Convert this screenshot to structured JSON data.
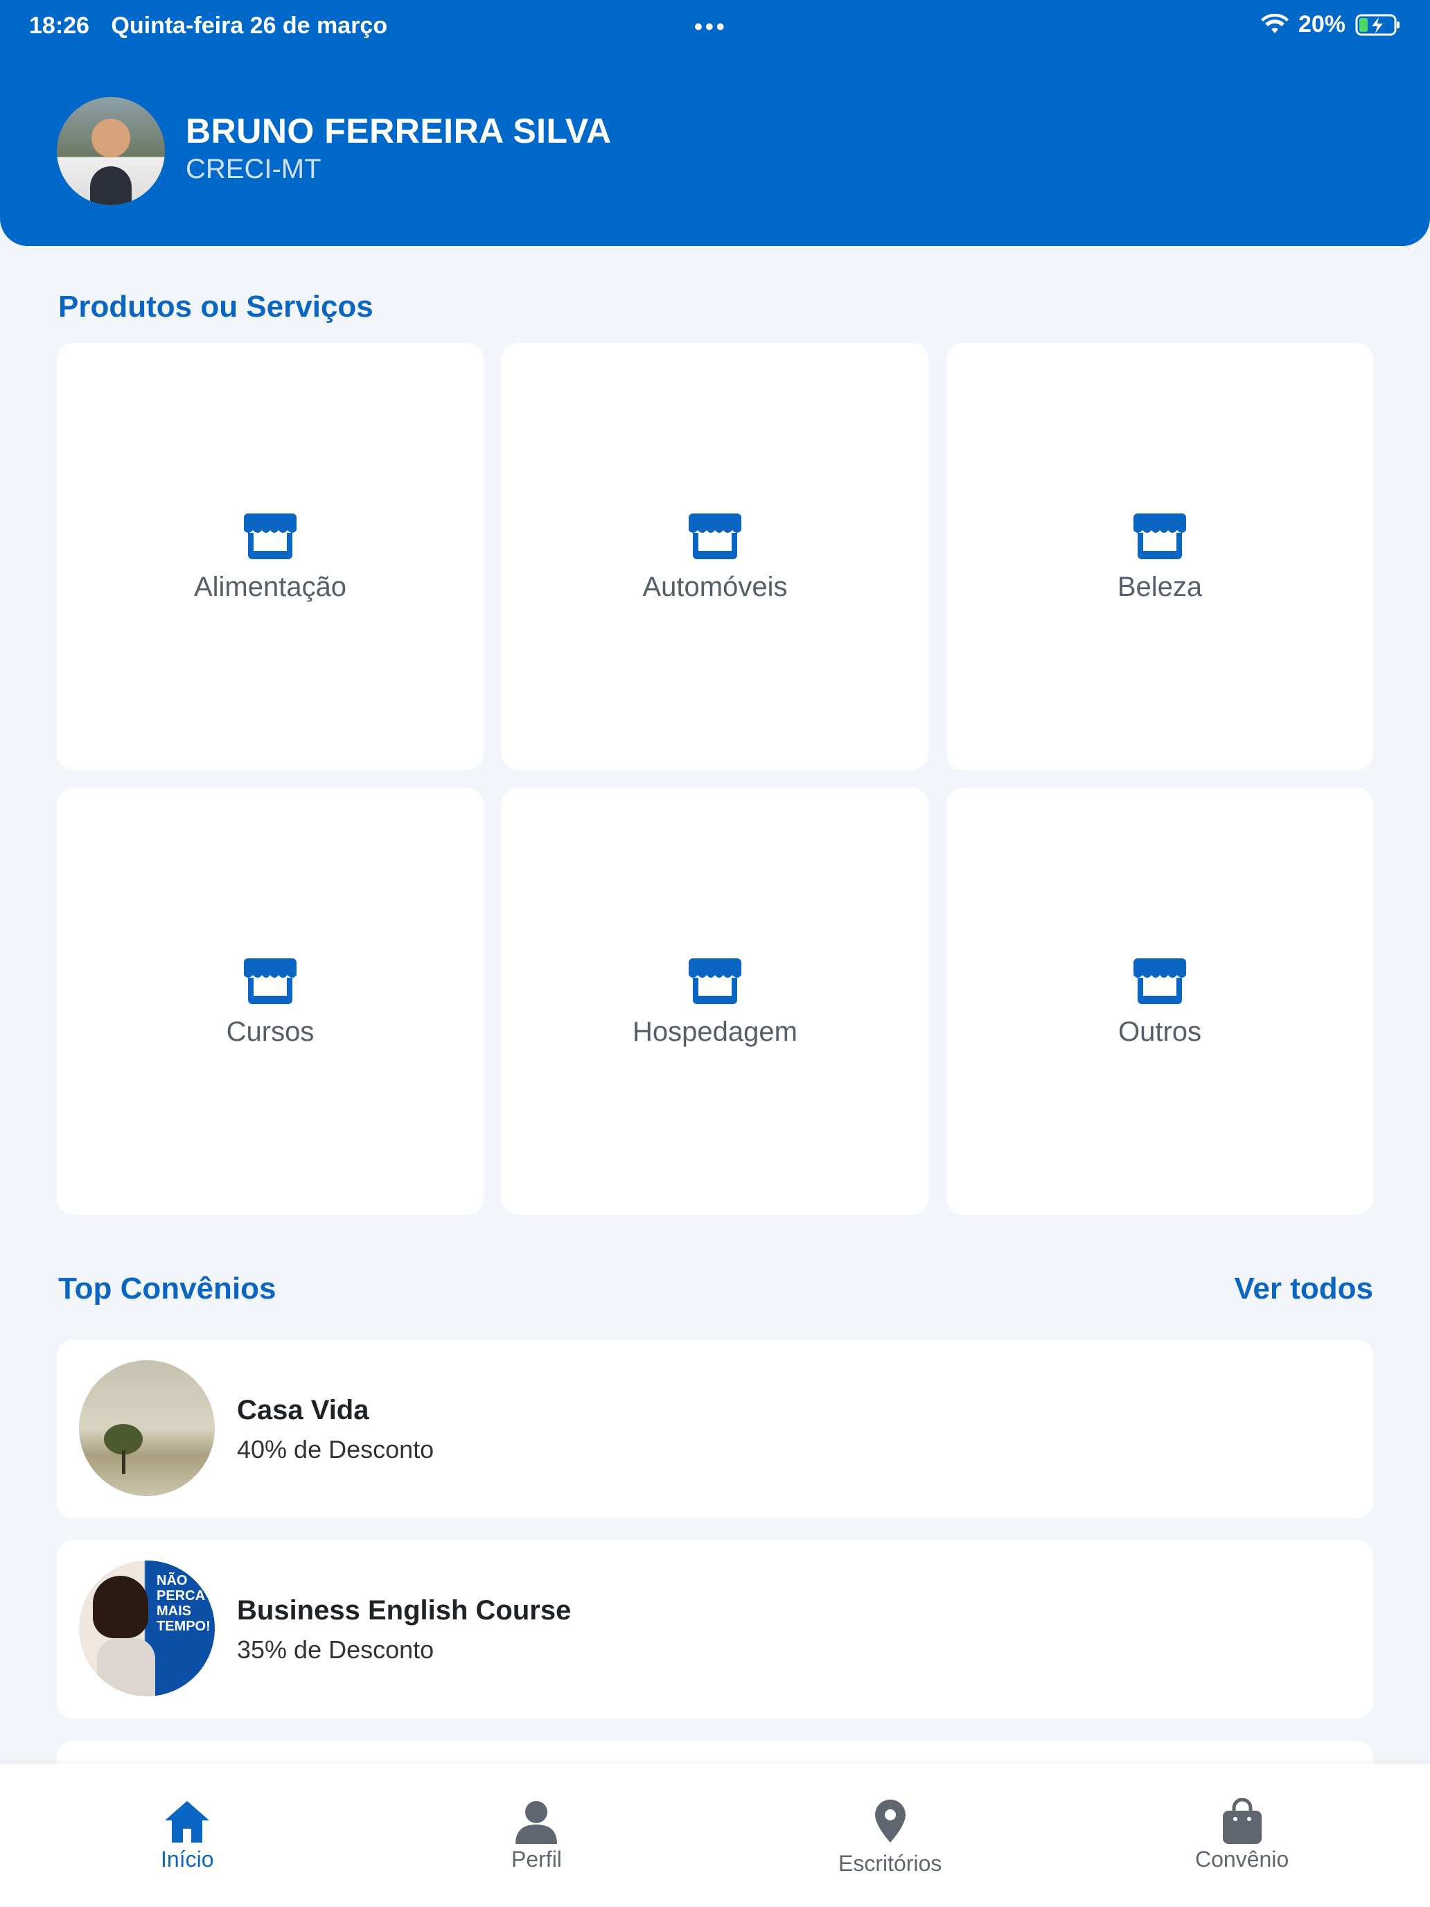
{
  "status_bar": {
    "time": "18:26",
    "date": "Quinta-feira 26 de março",
    "dots": "•••",
    "battery": "20%"
  },
  "profile": {
    "name": "BRUNO FERREIRA SILVA",
    "subtitle": "CRECI-MT"
  },
  "products": {
    "title": "Produtos ou Serviços",
    "icon": "store-icon",
    "items": [
      {
        "label": "Alimentação"
      },
      {
        "label": "Automóveis"
      },
      {
        "label": "Beleza"
      },
      {
        "label": "Cursos"
      },
      {
        "label": "Hospedagem"
      },
      {
        "label": "Outros"
      }
    ]
  },
  "top_convenios": {
    "title": "Top Convênios",
    "see_all": "Ver todos",
    "items": [
      {
        "title": "Casa Vida",
        "discount": "40% de Desconto"
      },
      {
        "title": "Business English Course",
        "discount": "35% de Desconto",
        "image_text": "NÃO PERCA MAIS TEMPO!"
      }
    ]
  },
  "bottom_nav": [
    {
      "label": "Início",
      "icon": "home-icon",
      "active": true
    },
    {
      "label": "Perfil",
      "icon": "person-icon",
      "active": false
    },
    {
      "label": "Escritórios",
      "icon": "location-pin-icon",
      "active": false
    },
    {
      "label": "Convênio",
      "icon": "shopping-bag-icon",
      "active": false
    }
  ],
  "colors": {
    "primary": "#0068c8",
    "accent_text": "#0a66c2",
    "background": "#f2f5f9",
    "card": "#ffffff"
  }
}
